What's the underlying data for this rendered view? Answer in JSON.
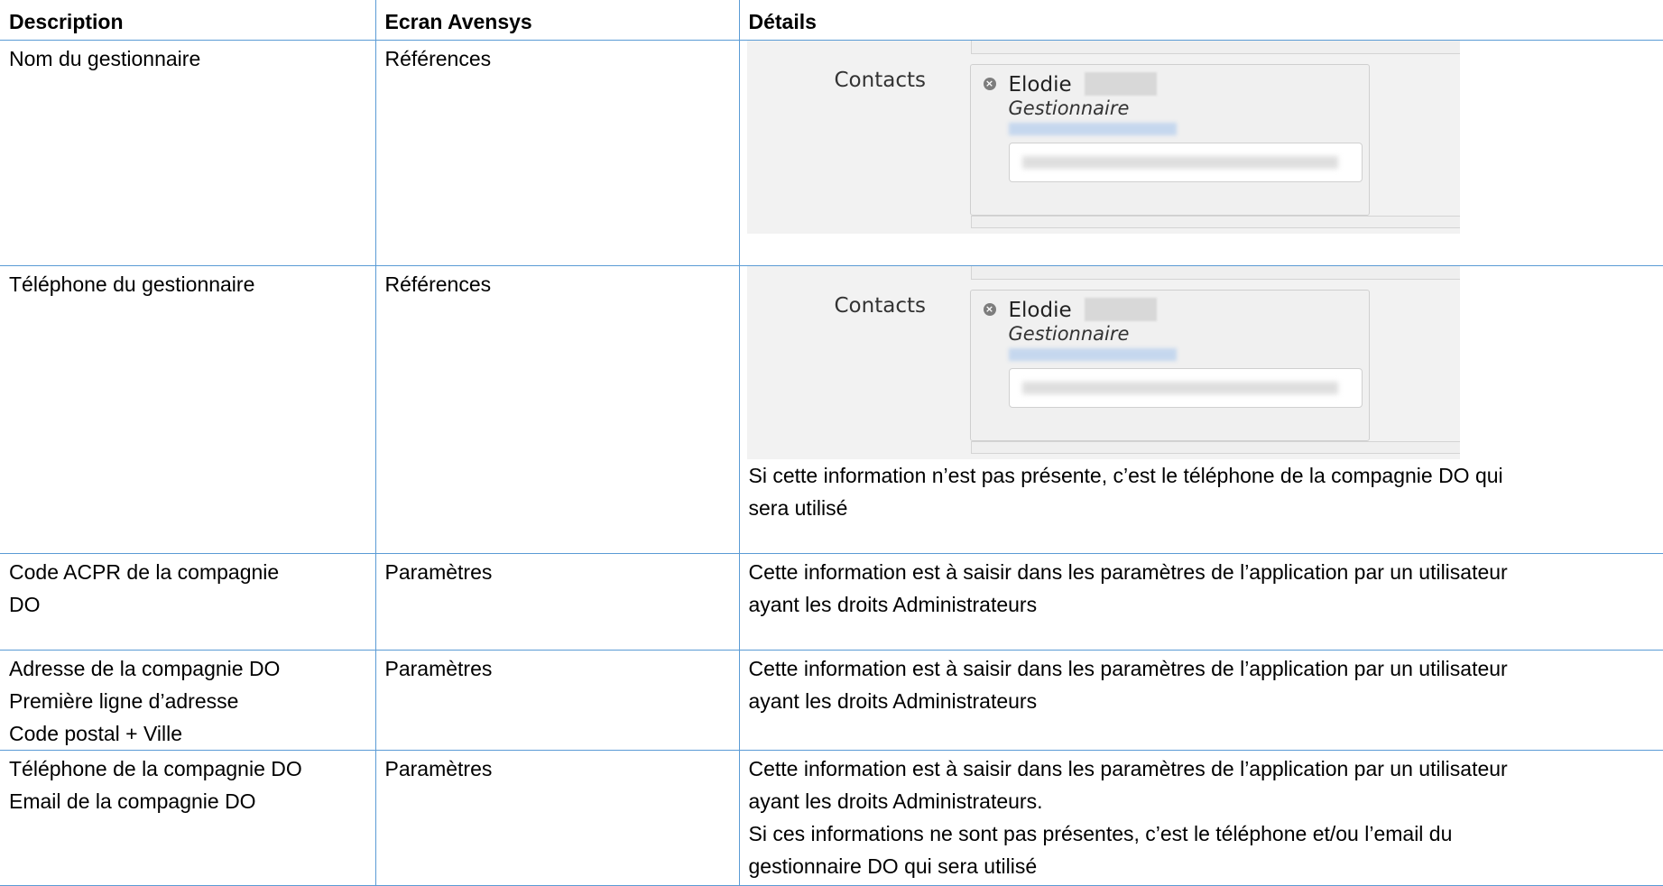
{
  "headers": [
    "Description",
    "Ecran Avensys",
    "Détails"
  ],
  "rows": [
    {
      "description": [
        "Nom du gestionnaire"
      ],
      "ecran": "Références",
      "details_text": [],
      "screenshot": {
        "label": "Contacts",
        "name": "Elodie",
        "role": "Gestionnaire"
      }
    },
    {
      "description": [
        "Téléphone du gestionnaire"
      ],
      "ecran": "Références",
      "details_text": [
        "Si cette information n’est pas présente, c’est le téléphone de la compagnie DO qui",
        "sera utilisé"
      ],
      "screenshot": {
        "label": "Contacts",
        "name": "Elodie",
        "role": "Gestionnaire"
      }
    },
    {
      "description": [
        "Code ACPR de la compagnie",
        "DO"
      ],
      "ecran": "Paramètres",
      "details_text": [
        "Cette information est à saisir dans les paramètres de l’application par un utilisateur",
        "ayant les droits Administrateurs"
      ]
    },
    {
      "description": [
        "Adresse de la compagnie DO",
        "Première ligne d’adresse",
        "Code postal + Ville"
      ],
      "ecran": "Paramètres",
      "details_text": [
        "Cette information est à saisir dans les paramètres de l’application par un utilisateur",
        "ayant les droits Administrateurs"
      ]
    },
    {
      "description": [
        "Téléphone de la compagnie DO",
        "Email de la compagnie DO"
      ],
      "ecran": "Paramètres",
      "details_text": [
        "Cette information est à saisir dans les paramètres de l’application par un utilisateur",
        "ayant les droits Administrateurs.",
        "Si ces informations ne sont pas présentes, c’est le téléphone et/ou l’email du",
        "gestionnaire DO qui sera utilisé"
      ]
    }
  ]
}
